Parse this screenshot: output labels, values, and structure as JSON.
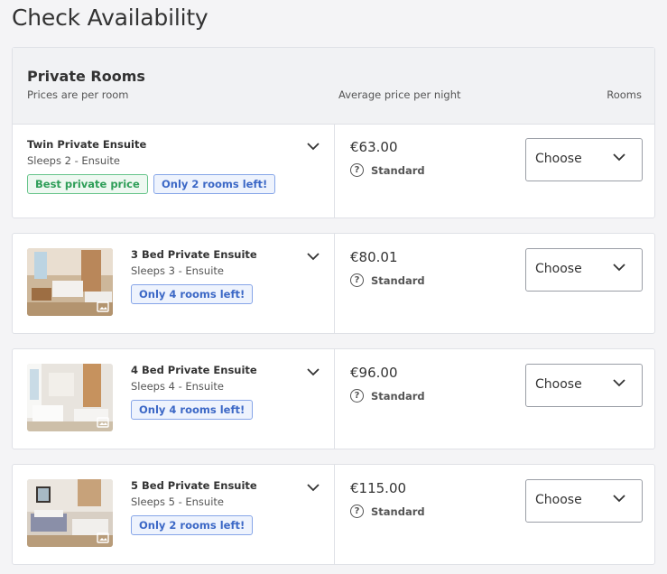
{
  "page": {
    "title": "Check Availability"
  },
  "section": {
    "title": "Private Rooms",
    "note": "Prices are per room",
    "price_header": "Average price per night",
    "rooms_header": "Rooms"
  },
  "rooms": [
    {
      "name": "Twin Private Ensuite",
      "sleeps": "Sleeps 2 - Ensuite",
      "badges": [
        "Best private price",
        "Only 2 rooms left!"
      ],
      "price": "€63.00",
      "rate": "Standard",
      "select": "Choose"
    },
    {
      "name": "3 Bed Private Ensuite",
      "sleeps": "Sleeps 3 - Ensuite",
      "badges": [
        "Only 4 rooms left!"
      ],
      "price": "€80.01",
      "rate": "Standard",
      "select": "Choose"
    },
    {
      "name": "4 Bed Private Ensuite",
      "sleeps": "Sleeps 4 - Ensuite",
      "badges": [
        "Only 4 rooms left!"
      ],
      "price": "€96.00",
      "rate": "Standard",
      "select": "Choose"
    },
    {
      "name": "5 Bed Private Ensuite",
      "sleeps": "Sleeps 5 - Ensuite",
      "badges": [
        "Only 2 rooms left!"
      ],
      "price": "€115.00",
      "rate": "Standard",
      "select": "Choose"
    }
  ],
  "icons": {
    "expand": "chevron-down-icon",
    "info": "help-icon",
    "gallery": "gallery-icon"
  },
  "colors": {
    "green_badge": "#2e9e58",
    "blue_badge": "#3c68c6",
    "background": "#f4f4f6"
  }
}
